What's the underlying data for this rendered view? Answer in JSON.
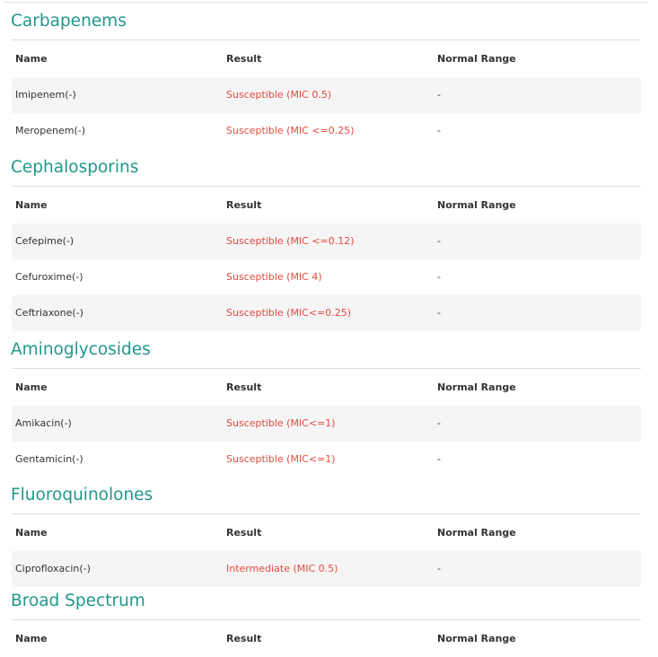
{
  "colors": {
    "section_title": "#21978b",
    "result_text": "#e14b3f",
    "zebra_row": "#f5f5f5",
    "rule": "#dcdcdc"
  },
  "sections": [
    {
      "title": "Carbapenems",
      "headers": {
        "name": "Name",
        "result": "Result",
        "range": "Normal Range"
      },
      "rows": [
        {
          "name": "Imipenem(-)",
          "result": "Susceptible (MIC 0.5)",
          "range": "-"
        },
        {
          "name": "Meropenem(-)",
          "result": "Susceptible (MIC <=0.25)",
          "range": "-"
        }
      ]
    },
    {
      "title": "Cephalosporins",
      "headers": {
        "name": "Name",
        "result": "Result",
        "range": "Normal Range"
      },
      "rows": [
        {
          "name": "Cefepime(-)",
          "result": "Susceptible (MIC <=0.12)",
          "range": "-"
        },
        {
          "name": "Cefuroxime(-)",
          "result": "Susceptible (MIC 4)",
          "range": "-"
        },
        {
          "name": "Ceftriaxone(-)",
          "result": "Susceptible (MIC<=0.25)",
          "range": "-"
        }
      ]
    },
    {
      "title": "Aminoglycosides",
      "headers": {
        "name": "Name",
        "result": "Result",
        "range": "Normal Range"
      },
      "rows": [
        {
          "name": "Amikacin(-)",
          "result": "Susceptible (MIC<=1)",
          "range": "-"
        },
        {
          "name": "Gentamicin(-)",
          "result": "Susceptible (MIC<=1)",
          "range": "-"
        }
      ]
    },
    {
      "title": "Fluoroquinolones",
      "headers": {
        "name": "Name",
        "result": "Result",
        "range": "Normal Range"
      },
      "rows": [
        {
          "name": "Ciprofloxacin(-)",
          "result": "Intermediate (MIC 0.5)",
          "range": "-"
        }
      ]
    },
    {
      "title": "Broad Spectrum",
      "headers": {
        "name": "Name",
        "result": "Result",
        "range": "Normal Range"
      },
      "rows": []
    }
  ]
}
